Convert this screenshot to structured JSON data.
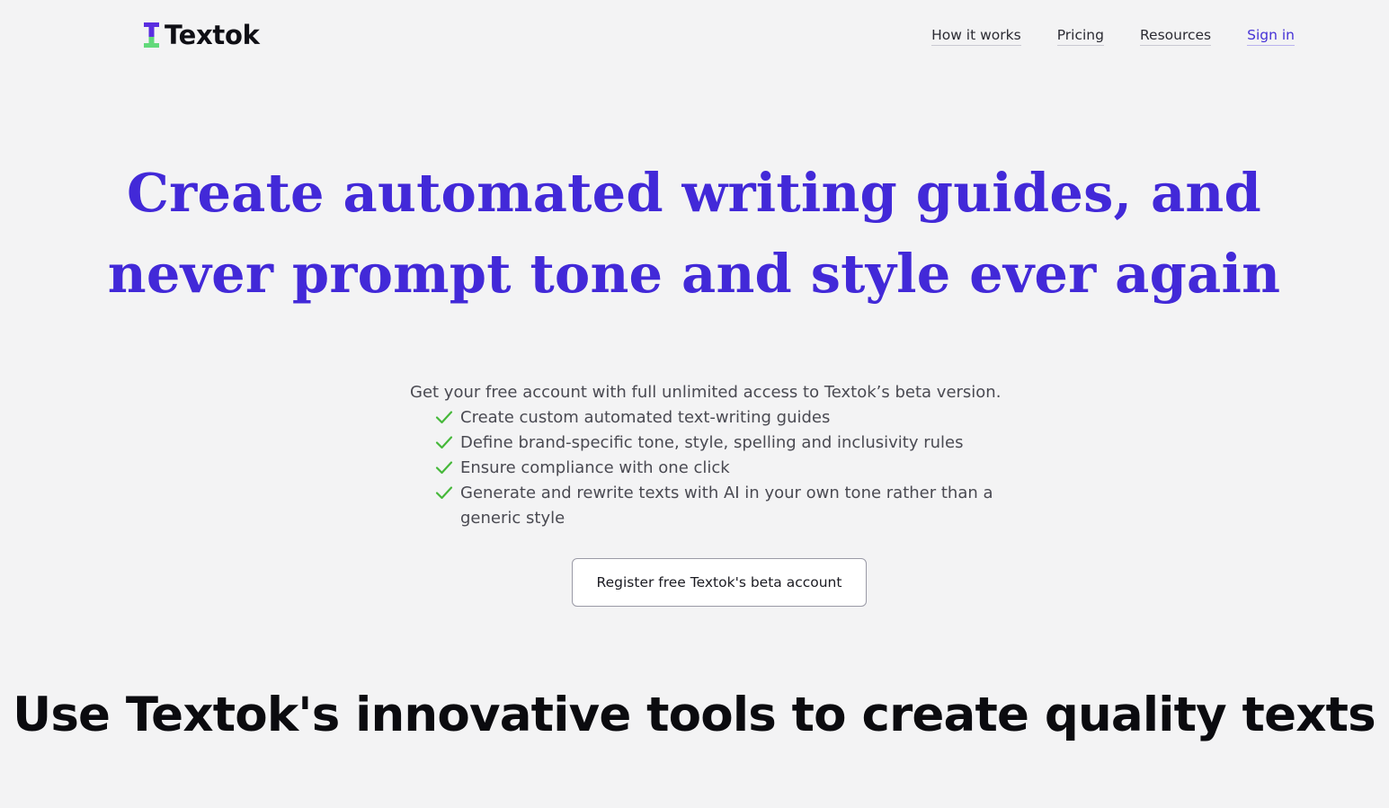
{
  "brand": {
    "name": "Textok",
    "colors": {
      "accent": "#4229d8",
      "logo_top": "#5a2de0",
      "logo_bottom": "#62d97a",
      "check": "#46b83a"
    }
  },
  "nav": {
    "items": [
      {
        "label": "How it works"
      },
      {
        "label": "Pricing"
      },
      {
        "label": "Resources"
      },
      {
        "label": "Sign in"
      }
    ]
  },
  "hero": {
    "title_line1": "Create automated writing guides, and",
    "title_line2": "never prompt tone and style ever again",
    "intro": "Get your free account with full unlimited access to Textok’s beta version.",
    "features": [
      {
        "text": "Create custom automated text-writing guides",
        "icon": "check-icon"
      },
      {
        "text": "Define brand-specific tone, style, spelling and inclusivity rules",
        "icon": "check-icon"
      },
      {
        "text": "Ensure compliance with one click",
        "icon": "check-icon"
      },
      {
        "text": "Generate and rewrite texts with AI in your own tone rather than a generic style",
        "icon": "check-icon"
      }
    ],
    "cta_label": "Register free Textok's beta account"
  },
  "section": {
    "title": "Use Textok's innovative tools to create quality texts"
  }
}
